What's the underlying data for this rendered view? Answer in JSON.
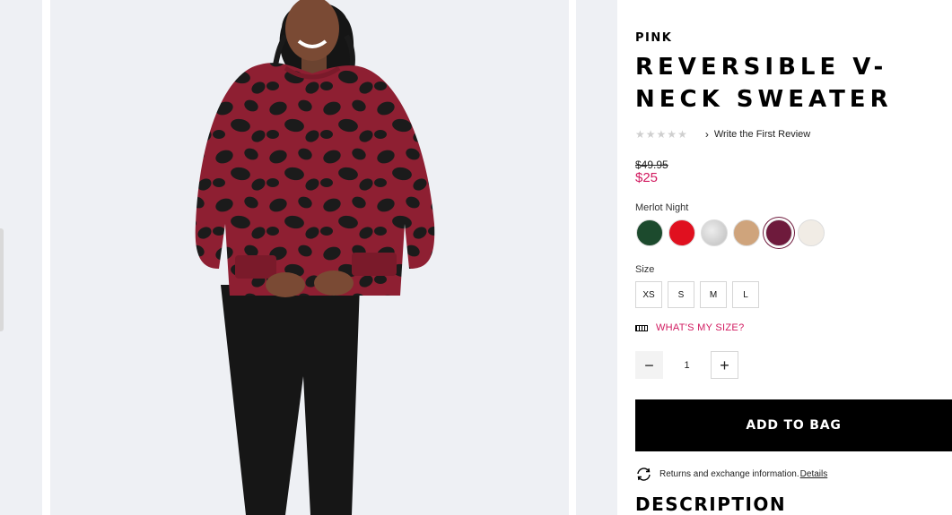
{
  "product": {
    "brand": "PINK",
    "title": "REVERSIBLE V-NECK SWEATER",
    "rating": {
      "stars": 0,
      "max": 5,
      "review_link": "Write the First Review"
    },
    "price": {
      "original": "$49.95",
      "sale": "$25"
    },
    "selected_color": "Merlot Night",
    "swatches": [
      {
        "name": "green",
        "hex": "#1c4a2d"
      },
      {
        "name": "red",
        "hex": "#e0101f"
      },
      {
        "name": "heather-grey",
        "hex": "#d2d2d2"
      },
      {
        "name": "tan",
        "hex": "#cfa47c"
      },
      {
        "name": "merlot",
        "hex": "#6e1a3c",
        "selected": true
      },
      {
        "name": "ivory",
        "hex": "#f1ece5"
      }
    ],
    "size_label": "Size",
    "sizes": [
      "XS",
      "S",
      "M",
      "L"
    ],
    "size_help": "WHAT'S MY SIZE?",
    "quantity": {
      "minus": "−",
      "value": "1",
      "plus": "+"
    },
    "add_to_bag": "ADD TO BAG",
    "returns": {
      "text": "Returns and exchange information.",
      "link": "Details"
    },
    "description_heading": "DESCRIPTION"
  },
  "colors": {
    "accent_pink": "#d1195f",
    "sweater_burgundy": "#8e1f32",
    "image_background": "#eef0f4"
  }
}
